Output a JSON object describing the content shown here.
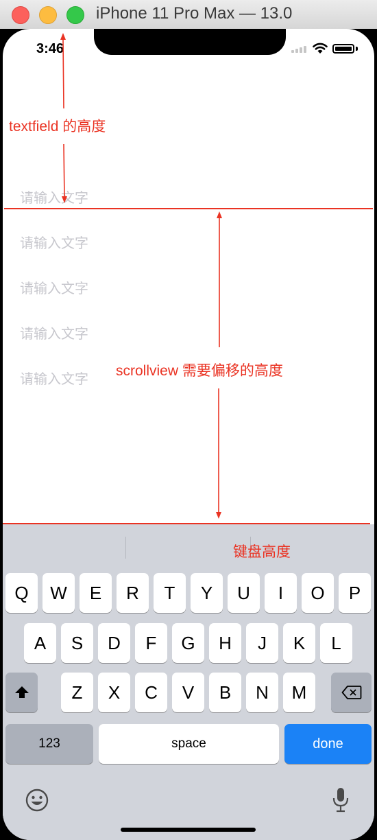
{
  "window": {
    "title": "iPhone 11 Pro Max — 13.0"
  },
  "status_bar": {
    "time": "3:46"
  },
  "text_fields": [
    {
      "placeholder": "请输入文字"
    },
    {
      "placeholder": "请输入文字"
    },
    {
      "placeholder": "请输入文字"
    },
    {
      "placeholder": "请输入文字"
    },
    {
      "placeholder": "请输入文字"
    }
  ],
  "annotations": {
    "textfield_height": "textfield 的高度",
    "scroll_offset": "scrollview 需要偏移的高度",
    "keyboard_height": "键盘高度",
    "color": "#ea3323"
  },
  "keyboard": {
    "row1": [
      "Q",
      "W",
      "E",
      "R",
      "T",
      "Y",
      "U",
      "I",
      "O",
      "P"
    ],
    "row2": [
      "A",
      "S",
      "D",
      "F",
      "G",
      "H",
      "J",
      "K",
      "L"
    ],
    "row3": [
      "Z",
      "X",
      "C",
      "V",
      "B",
      "N",
      "M"
    ],
    "shift_icon": "shift-icon",
    "delete_icon": "delete-icon",
    "numbers_label": "123",
    "space_label": "space",
    "done_label": "done",
    "emoji_icon": "emoji-icon",
    "mic_icon": "microphone-icon",
    "done_color": "#1b82f6"
  }
}
